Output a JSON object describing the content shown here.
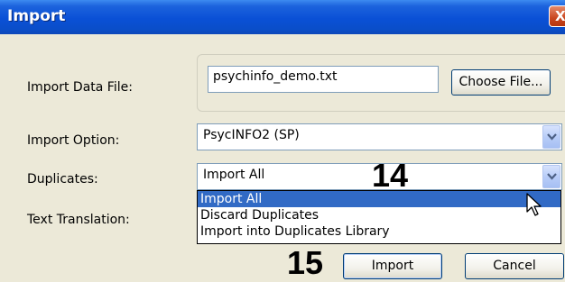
{
  "window": {
    "title": "Import",
    "close_glyph": "X"
  },
  "form": {
    "import_data_file": {
      "label": "Import Data File:",
      "value": "psychinfo_demo.txt",
      "button": "Choose File..."
    },
    "import_option": {
      "label": "Import Option:",
      "value": "PsycINFO2 (SP)"
    },
    "duplicates": {
      "label": "Duplicates:",
      "value": "Import All",
      "options": [
        "Import All",
        "Discard Duplicates",
        "Import into Duplicates Library"
      ]
    },
    "text_translation": {
      "label": "Text Translation:"
    }
  },
  "annotations": {
    "step_14": "14",
    "step_15": "15"
  },
  "buttons": {
    "import": "Import",
    "cancel": "Cancel"
  },
  "icons": {
    "dropdown": "chevron-down-icon",
    "cursor": "mouse-pointer-icon",
    "close": "close-icon"
  },
  "colors": {
    "titlebar": "#0a50d6",
    "selection": "#316ac5",
    "dialog": "#ece9d8"
  }
}
